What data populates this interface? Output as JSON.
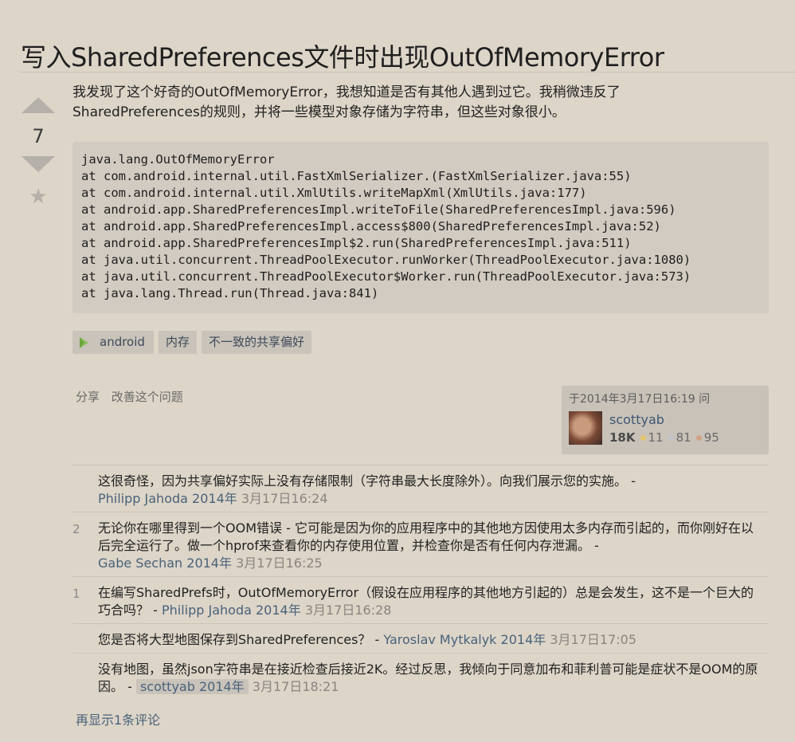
{
  "question": {
    "title": "写入SharedPreferences文件时出现OutOfMemoryError",
    "score": "7",
    "body_line1": "我发现了这个好奇的OutOfMemoryError，我想知道是否有其他人遇到过它。我稍微违反了",
    "body_line2": "SharedPreferences的规则，并将一些模型对象存储为字符串，但这些对象很小。",
    "code": [
      "java.lang.OutOfMemoryError",
      "at com.android.internal.util.FastXmlSerializer.(FastXmlSerializer.java:55)",
      "at com.android.internal.util.XmlUtils.writeMapXml(XmlUtils.java:177)",
      "at android.app.SharedPreferencesImpl.writeToFile(SharedPreferencesImpl.java:596)",
      "at android.app.SharedPreferencesImpl.access$800(SharedPreferencesImpl.java:52)",
      "at android.app.SharedPreferencesImpl$2.run(SharedPreferencesImpl.java:511)",
      "at java.util.concurrent.ThreadPoolExecutor.runWorker(ThreadPoolExecutor.java:1080)",
      "at java.util.concurrent.ThreadPoolExecutor$Worker.run(ThreadPoolExecutor.java:573)",
      "at java.lang.Thread.run(Thread.java:841)"
    ],
    "tags": [
      "android",
      "内存",
      "不一致的共享偏好"
    ],
    "menu": {
      "share": "分享",
      "improve": "改善这个问题"
    },
    "owner": {
      "asked": "于2014年3月17日16:19 问",
      "name": "scottyab",
      "rep": "18K",
      "gold": "11",
      "silver": "81",
      "bronze": "95"
    }
  },
  "comments": [
    {
      "score": "",
      "text": "这很奇怪，因为共享偏好实际上没有存储限制（字符串最大长度除外）。向我们展示您的实施。 -",
      "user": "Philipp Jahoda 2014年",
      "date": "3月17日16:24"
    },
    {
      "score": "2",
      "text": "无论你在哪里得到一个OOM错误 - 它可能是因为你的应用程序中的其他地方因使用太多内存而引起的，而你刚好在以后完全运行了。做一个hprof来查看你的内存使用位置，并检查你是否有任何内存泄漏。 -",
      "user": "Gabe Sechan 2014年",
      "date": "3月17日16:25"
    },
    {
      "score": "1",
      "text": "在编写SharedPrefs时，OutOfMemoryError（假设在应用程序的其他地方引起的）总是会发生，这不是一个巨大的巧合吗？ -",
      "user": "Philipp Jahoda 2014年",
      "date": "3月17日16:28"
    },
    {
      "score": "",
      "text": "您是否将大型地图保存到SharedPreferences？ -",
      "user": "Yaroslav Mytkalyk 2014年",
      "date": "3月17日17:05"
    },
    {
      "score": "",
      "text": "没有地图，虽然json字符串是在接近检查后接近2K。经过反思，我倾向于同意加布和菲利普可能是症状不是OOM的原因。 -",
      "user": "scottyab 2014年",
      "date": "3月17日18:21"
    }
  ],
  "show_more": "再显示1条评论",
  "colors": {
    "background": "#ddd5c8",
    "link": "#49627a",
    "tag_bg": "#c9c3ba"
  },
  "icons": [
    "vote-up-icon",
    "vote-down-icon",
    "favorite-star-icon",
    "android-icon"
  ]
}
